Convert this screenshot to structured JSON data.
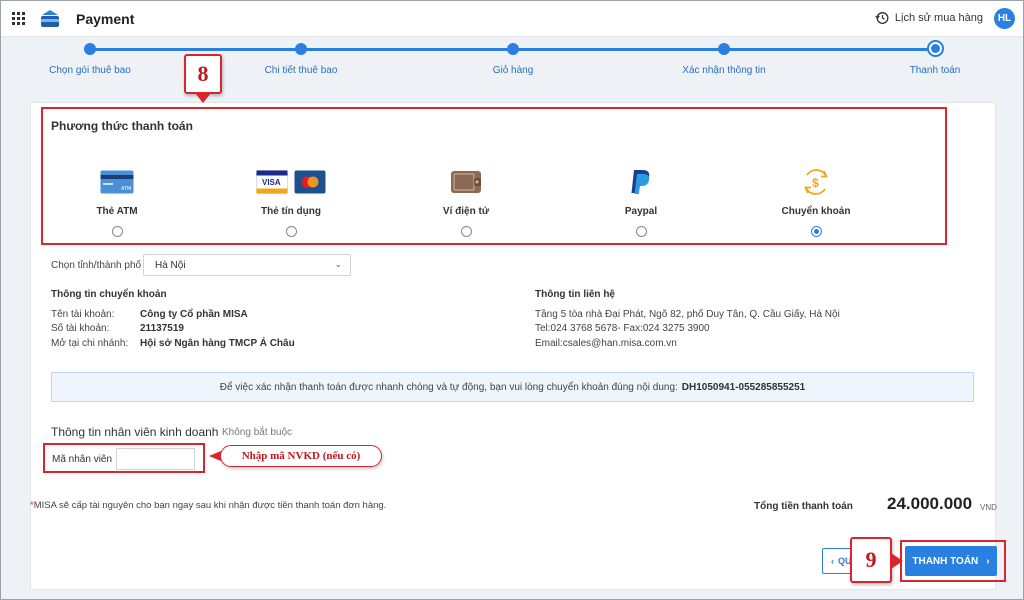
{
  "header": {
    "app_title": "Payment",
    "history_label": "Lịch sử mua hàng",
    "avatar_initials": "HL"
  },
  "stepper": {
    "steps": [
      {
        "label": "Chọn gói thuê bao"
      },
      {
        "label": "Chi tiết thuê bao"
      },
      {
        "label": "Giỏ hàng"
      },
      {
        "label": "Xác nhận thông tin"
      },
      {
        "label": "Thanh toán"
      }
    ],
    "active_index": 4,
    "accent_color": "#2a80e0"
  },
  "payment_method": {
    "title": "Phương thức thanh toán",
    "options": [
      {
        "label": "Thẻ ATM",
        "icon": "atm-card-icon",
        "selected": false
      },
      {
        "label": "Thẻ tín dụng",
        "icon": "credit-card-icon",
        "selected": false
      },
      {
        "label": "Ví điện tử",
        "icon": "wallet-icon",
        "selected": false
      },
      {
        "label": "Paypal",
        "icon": "paypal-icon",
        "selected": false
      },
      {
        "label": "Chuyển khoản",
        "icon": "bank-transfer-icon",
        "selected": true
      }
    ],
    "visa_text": "VISA",
    "atm_text": "ATM"
  },
  "city": {
    "label": "Chọn tỉnh/thành phố",
    "selected": "Hà Nội"
  },
  "transfer_info": {
    "title": "Thông tin chuyển khoản",
    "rows": [
      {
        "label": "Tên tài khoản:",
        "value": "Công ty Cổ phần MISA"
      },
      {
        "label": "Số tài khoản:",
        "value": "21137519"
      },
      {
        "label": "Mở tại chi nhánh:",
        "value": "Hội sở Ngân hàng TMCP Á Châu"
      }
    ]
  },
  "contact_info": {
    "title": "Thông tin liên hệ",
    "lines": [
      "Tầng 5 tòa nhà Đại Phát, Ngõ 82, phố Duy Tân, Q. Cầu Giấy, Hà Nội",
      "Tel:024 3768 5678- Fax:024 3275 3900",
      "Email:csales@han.misa.com.vn"
    ]
  },
  "notice": {
    "text": "Để việc xác nhận thanh toán được nhanh chóng và tự động, bạn vui lòng chuyển khoản đúng nội dung:",
    "code": "DH1050941-055285855251"
  },
  "employee": {
    "title": "Thông tin nhân viên kinh doanh",
    "optional": "Không bắt buộc",
    "field_label": "Mã nhân viên",
    "field_value": ""
  },
  "annotations": {
    "step8": "8",
    "step9": "9",
    "hint": "Nhập mã NVKD (nếu có)",
    "highlight_color": "#d9262e"
  },
  "footer": {
    "footnote_star": "*",
    "footnote": "MISA sẽ cấp tài nguyên cho bạn ngay sau khi nhận được tiền thanh toán đơn hàng.",
    "total_label": "Tổng tiền thanh toán",
    "total_value": "24.000.000",
    "total_unit": "VND",
    "back_label": "QU",
    "pay_label": "THANH TOÁN"
  }
}
